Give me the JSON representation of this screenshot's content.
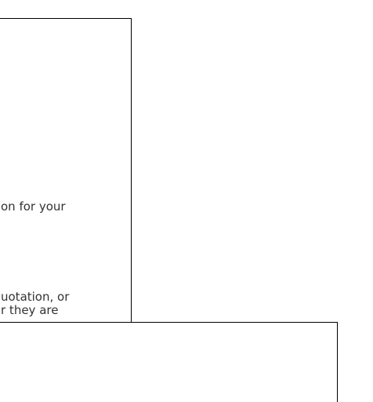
{
  "upper_panel": {
    "lines": [
      "on for your",
      "uotation, or",
      "r they are"
    ]
  },
  "lower_panel": {}
}
